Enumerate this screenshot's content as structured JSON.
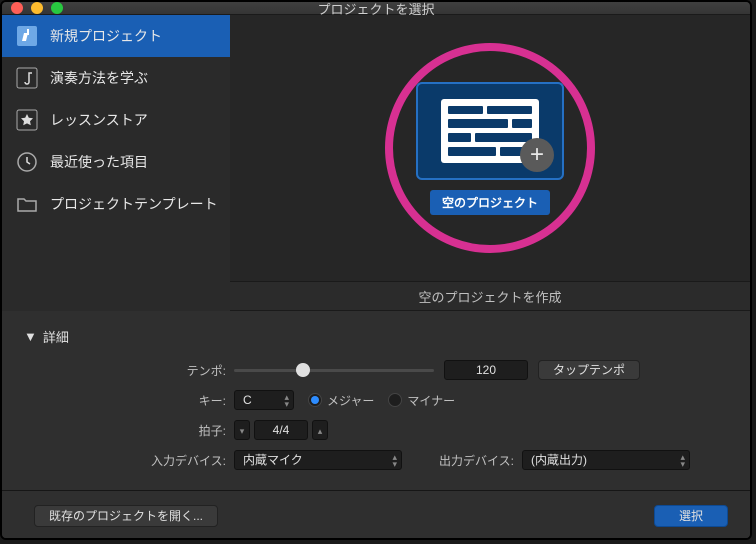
{
  "window": {
    "title": "プロジェクトを選択"
  },
  "sidebar": {
    "items": [
      {
        "label": "新規プロジェクト"
      },
      {
        "label": "演奏方法を学ぶ"
      },
      {
        "label": "レッスンストア"
      },
      {
        "label": "最近使った項目"
      },
      {
        "label": "プロジェクトテンプレート"
      }
    ]
  },
  "template": {
    "label": "空のプロジェクト",
    "description": "空のプロジェクトを作成"
  },
  "details": {
    "header": "詳細",
    "tempo_label": "テンポ:",
    "tempo_value": "120",
    "tap_tempo": "タップテンポ",
    "key_label": "キー:",
    "key_value": "C",
    "major": "メジャー",
    "minor": "マイナー",
    "timesig_label": "拍子:",
    "timesig_value": "4/4",
    "input_device_label": "入力デバイス:",
    "input_device_value": "内蔵マイク",
    "output_device_label": "出力デバイス:",
    "output_device_value": "(内蔵出力)"
  },
  "footer": {
    "open_existing": "既存のプロジェクトを開く...",
    "choose": "選択"
  }
}
